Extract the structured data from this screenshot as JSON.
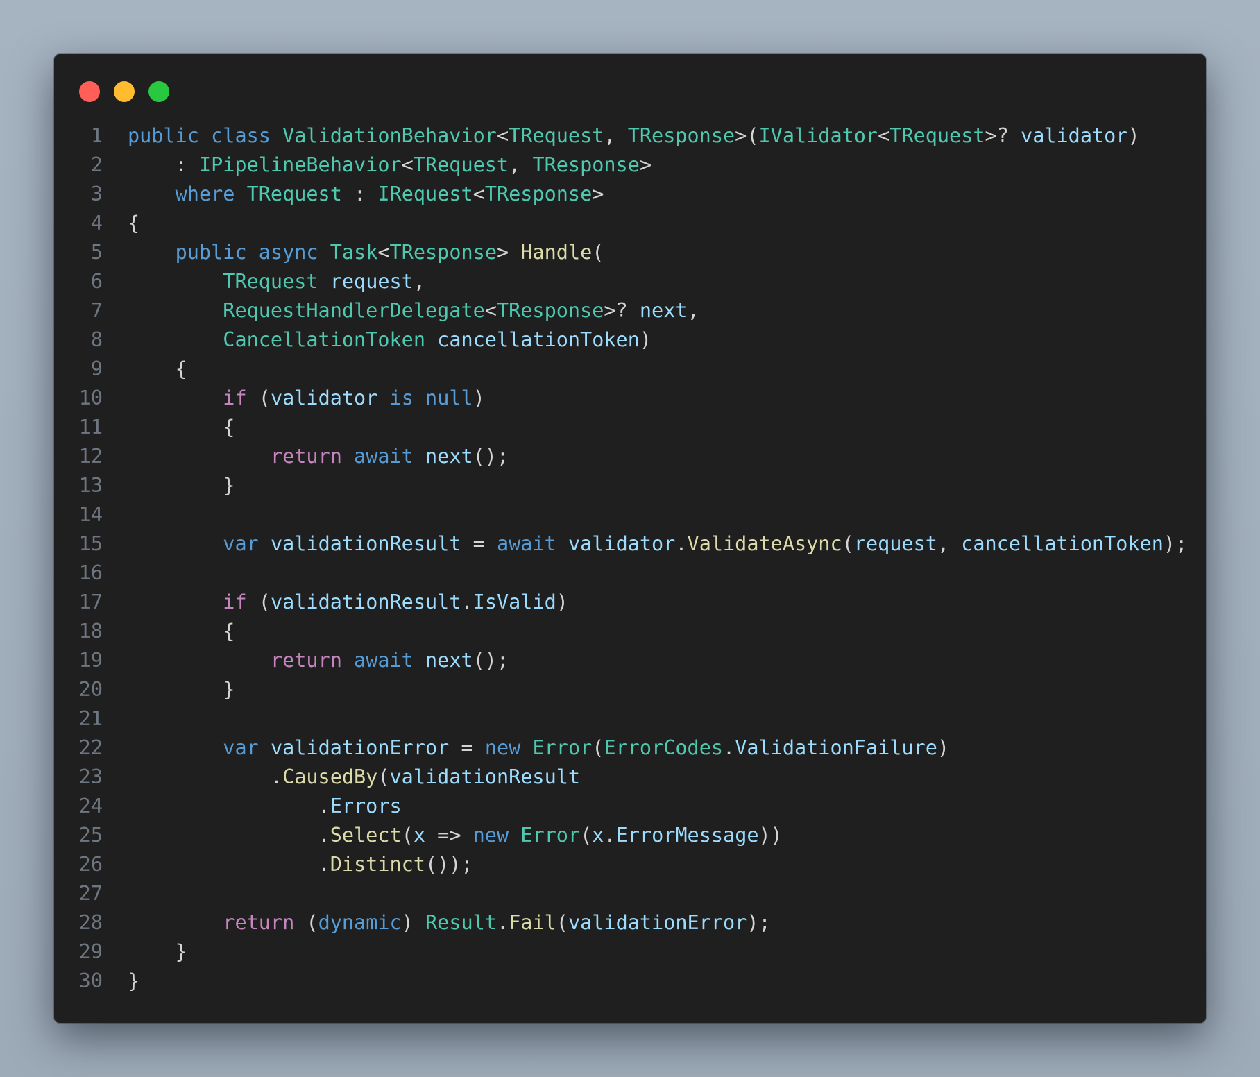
{
  "window": {
    "traffic_lights": [
      {
        "name": "close",
        "color": "#ff5f57"
      },
      {
        "name": "minimize",
        "color": "#febc2e"
      },
      {
        "name": "zoom",
        "color": "#28c840"
      }
    ]
  },
  "colors": {
    "background": "#a4b1be",
    "editor_background": "#1f1f1f",
    "keyword": "#569cd6",
    "control_keyword": "#c586c0",
    "type": "#4ec9b0",
    "method": "#dcdcaa",
    "variable": "#9cdcfe",
    "punctuation": "#d4d4d4",
    "line_number": "#6e7681"
  },
  "language": "csharp",
  "code_lines": [
    {
      "n": "1",
      "tokens": [
        [
          "public",
          "kw"
        ],
        [
          " ",
          "p"
        ],
        [
          "class",
          "kw"
        ],
        [
          " ",
          "p"
        ],
        [
          "ValidationBehavior",
          "ty"
        ],
        [
          "<",
          "p"
        ],
        [
          "TRequest",
          "ty"
        ],
        [
          ", ",
          "p"
        ],
        [
          "TResponse",
          "ty"
        ],
        [
          ">(",
          "p"
        ],
        [
          "IValidator",
          "ty"
        ],
        [
          "<",
          "p"
        ],
        [
          "TRequest",
          "ty"
        ],
        [
          ">? ",
          "p"
        ],
        [
          "validator",
          "var"
        ],
        [
          ")",
          "p"
        ]
      ]
    },
    {
      "n": "2",
      "tokens": [
        [
          "    : ",
          "p"
        ],
        [
          "IPipelineBehavior",
          "ty"
        ],
        [
          "<",
          "p"
        ],
        [
          "TRequest",
          "ty"
        ],
        [
          ", ",
          "p"
        ],
        [
          "TResponse",
          "ty"
        ],
        [
          ">",
          "p"
        ]
      ]
    },
    {
      "n": "3",
      "tokens": [
        [
          "    ",
          "p"
        ],
        [
          "where",
          "kw"
        ],
        [
          " ",
          "p"
        ],
        [
          "TRequest",
          "ty"
        ],
        [
          " : ",
          "p"
        ],
        [
          "IRequest",
          "ty"
        ],
        [
          "<",
          "p"
        ],
        [
          "TResponse",
          "ty"
        ],
        [
          ">",
          "p"
        ]
      ]
    },
    {
      "n": "4",
      "tokens": [
        [
          "{",
          "p"
        ]
      ]
    },
    {
      "n": "5",
      "tokens": [
        [
          "    ",
          "p"
        ],
        [
          "public",
          "kw"
        ],
        [
          " ",
          "p"
        ],
        [
          "async",
          "kw"
        ],
        [
          " ",
          "p"
        ],
        [
          "Task",
          "ty"
        ],
        [
          "<",
          "p"
        ],
        [
          "TResponse",
          "ty"
        ],
        [
          "> ",
          "p"
        ],
        [
          "Handle",
          "fn"
        ],
        [
          "(",
          "p"
        ]
      ]
    },
    {
      "n": "6",
      "tokens": [
        [
          "        ",
          "p"
        ],
        [
          "TRequest",
          "ty"
        ],
        [
          " ",
          "p"
        ],
        [
          "request",
          "var"
        ],
        [
          ",",
          "p"
        ]
      ]
    },
    {
      "n": "7",
      "tokens": [
        [
          "        ",
          "p"
        ],
        [
          "RequestHandlerDelegate",
          "ty"
        ],
        [
          "<",
          "p"
        ],
        [
          "TResponse",
          "ty"
        ],
        [
          ">? ",
          "p"
        ],
        [
          "next",
          "var"
        ],
        [
          ",",
          "p"
        ]
      ]
    },
    {
      "n": "8",
      "tokens": [
        [
          "        ",
          "p"
        ],
        [
          "CancellationToken",
          "ty"
        ],
        [
          " ",
          "p"
        ],
        [
          "cancellationToken",
          "var"
        ],
        [
          ")",
          "p"
        ]
      ]
    },
    {
      "n": "9",
      "tokens": [
        [
          "    {",
          "p"
        ]
      ]
    },
    {
      "n": "10",
      "tokens": [
        [
          "        ",
          "p"
        ],
        [
          "if",
          "ctl"
        ],
        [
          " (",
          "p"
        ],
        [
          "validator",
          "var"
        ],
        [
          " ",
          "p"
        ],
        [
          "is",
          "kw"
        ],
        [
          " ",
          "p"
        ],
        [
          "null",
          "kw"
        ],
        [
          ")",
          "p"
        ]
      ]
    },
    {
      "n": "11",
      "tokens": [
        [
          "        {",
          "p"
        ]
      ]
    },
    {
      "n": "12",
      "tokens": [
        [
          "            ",
          "p"
        ],
        [
          "return",
          "ctl"
        ],
        [
          " ",
          "p"
        ],
        [
          "await",
          "kw"
        ],
        [
          " ",
          "p"
        ],
        [
          "next",
          "var"
        ],
        [
          "();",
          "p"
        ]
      ]
    },
    {
      "n": "13",
      "tokens": [
        [
          "        }",
          "p"
        ]
      ]
    },
    {
      "n": "14",
      "tokens": []
    },
    {
      "n": "15",
      "tokens": [
        [
          "        ",
          "p"
        ],
        [
          "var",
          "kw"
        ],
        [
          " ",
          "p"
        ],
        [
          "validationResult",
          "var"
        ],
        [
          " = ",
          "p"
        ],
        [
          "await",
          "kw"
        ],
        [
          " ",
          "p"
        ],
        [
          "validator",
          "var"
        ],
        [
          ".",
          "p"
        ],
        [
          "ValidateAsync",
          "fn"
        ],
        [
          "(",
          "p"
        ],
        [
          "request",
          "var"
        ],
        [
          ", ",
          "p"
        ],
        [
          "cancellationToken",
          "var"
        ],
        [
          ");",
          "p"
        ]
      ]
    },
    {
      "n": "16",
      "tokens": []
    },
    {
      "n": "17",
      "tokens": [
        [
          "        ",
          "p"
        ],
        [
          "if",
          "ctl"
        ],
        [
          " (",
          "p"
        ],
        [
          "validationResult",
          "var"
        ],
        [
          ".",
          "p"
        ],
        [
          "IsValid",
          "var"
        ],
        [
          ")",
          "p"
        ]
      ]
    },
    {
      "n": "18",
      "tokens": [
        [
          "        {",
          "p"
        ]
      ]
    },
    {
      "n": "19",
      "tokens": [
        [
          "            ",
          "p"
        ],
        [
          "return",
          "ctl"
        ],
        [
          " ",
          "p"
        ],
        [
          "await",
          "kw"
        ],
        [
          " ",
          "p"
        ],
        [
          "next",
          "var"
        ],
        [
          "();",
          "p"
        ]
      ]
    },
    {
      "n": "20",
      "tokens": [
        [
          "        }",
          "p"
        ]
      ]
    },
    {
      "n": "21",
      "tokens": []
    },
    {
      "n": "22",
      "tokens": [
        [
          "        ",
          "p"
        ],
        [
          "var",
          "kw"
        ],
        [
          " ",
          "p"
        ],
        [
          "validationError",
          "var"
        ],
        [
          " = ",
          "p"
        ],
        [
          "new",
          "kw"
        ],
        [
          " ",
          "p"
        ],
        [
          "Error",
          "ty"
        ],
        [
          "(",
          "p"
        ],
        [
          "ErrorCodes",
          "ty"
        ],
        [
          ".",
          "p"
        ],
        [
          "ValidationFailure",
          "var"
        ],
        [
          ")",
          "p"
        ]
      ]
    },
    {
      "n": "23",
      "tokens": [
        [
          "            .",
          "p"
        ],
        [
          "CausedBy",
          "fn"
        ],
        [
          "(",
          "p"
        ],
        [
          "validationResult",
          "var"
        ]
      ]
    },
    {
      "n": "24",
      "tokens": [
        [
          "                .",
          "p"
        ],
        [
          "Errors",
          "var"
        ]
      ]
    },
    {
      "n": "25",
      "tokens": [
        [
          "                .",
          "p"
        ],
        [
          "Select",
          "fn"
        ],
        [
          "(",
          "p"
        ],
        [
          "x",
          "var"
        ],
        [
          " => ",
          "p"
        ],
        [
          "new",
          "kw"
        ],
        [
          " ",
          "p"
        ],
        [
          "Error",
          "ty"
        ],
        [
          "(",
          "p"
        ],
        [
          "x",
          "var"
        ],
        [
          ".",
          "p"
        ],
        [
          "ErrorMessage",
          "var"
        ],
        [
          "))",
          "p"
        ]
      ]
    },
    {
      "n": "26",
      "tokens": [
        [
          "                .",
          "p"
        ],
        [
          "Distinct",
          "fn"
        ],
        [
          "());",
          "p"
        ]
      ]
    },
    {
      "n": "27",
      "tokens": []
    },
    {
      "n": "28",
      "tokens": [
        [
          "        ",
          "p"
        ],
        [
          "return",
          "ctl"
        ],
        [
          " (",
          "p"
        ],
        [
          "dynamic",
          "kw"
        ],
        [
          ") ",
          "p"
        ],
        [
          "Result",
          "ty"
        ],
        [
          ".",
          "p"
        ],
        [
          "Fail",
          "fn"
        ],
        [
          "(",
          "p"
        ],
        [
          "validationError",
          "var"
        ],
        [
          ");",
          "p"
        ]
      ]
    },
    {
      "n": "29",
      "tokens": [
        [
          "    }",
          "p"
        ]
      ]
    },
    {
      "n": "30",
      "tokens": [
        [
          "}",
          "p"
        ]
      ]
    }
  ]
}
